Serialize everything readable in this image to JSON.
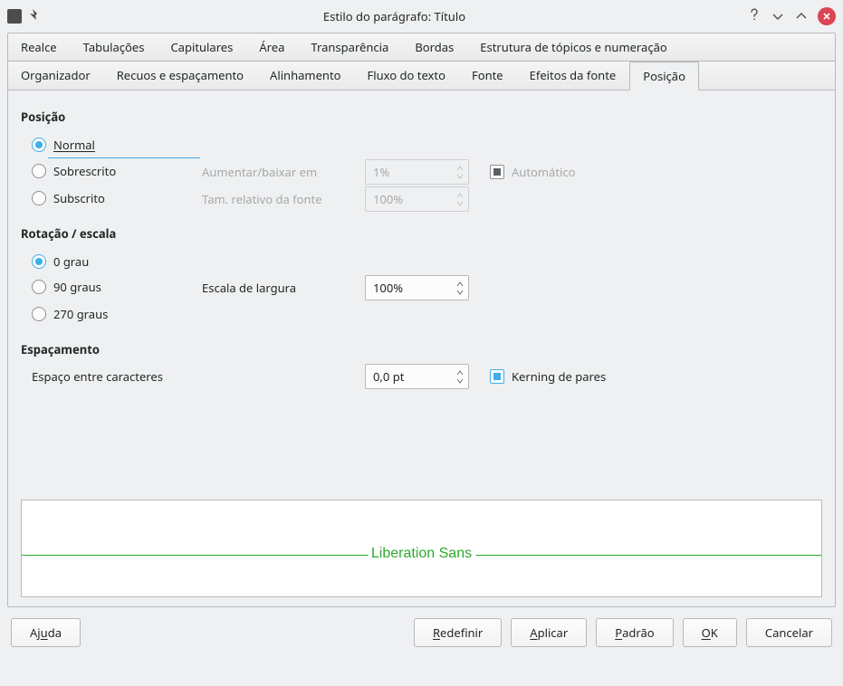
{
  "titlebar": {
    "title": "Estilo do parágrafo: Título"
  },
  "tabs_row1": [
    "Realce",
    "Tabulações",
    "Capitulares",
    "Área",
    "Transparência",
    "Bordas",
    "Estrutura de tópicos e numeração"
  ],
  "tabs_row2": [
    "Organizador",
    "Recuos e espaçamento",
    "Alinhamento",
    "Fluxo do texto",
    "Fonte",
    "Efeitos da fonte",
    "Posição"
  ],
  "active_tab": "Posição",
  "position": {
    "section": "Posição",
    "normal": "Normal",
    "sobrescrito": "Sobrescrito",
    "subscrito": "Subscrito",
    "raise_label": "Aumentar/baixar em",
    "raise_value": "1%",
    "relsize_label": "Tam. relativo da fonte",
    "relsize_value": "100%",
    "auto_label": "Automático"
  },
  "rotation": {
    "section": "Rotação / escala",
    "deg0": "0 grau",
    "deg90": "90 graus",
    "deg270": "270 graus",
    "scale_label": "Escala de largura",
    "scale_value": "100%"
  },
  "spacing": {
    "section": "Espaçamento",
    "char_label": "Espaço entre caracteres",
    "char_value": "0,0 pt",
    "kerning_label": "Kerning de pares"
  },
  "preview": {
    "font": "Liberation Sans"
  },
  "buttons": {
    "help": "Ajuda",
    "reset": "Redefinir",
    "apply": "Aplicar",
    "default": "Padrão",
    "ok": "OK",
    "cancel": "Cancelar"
  }
}
